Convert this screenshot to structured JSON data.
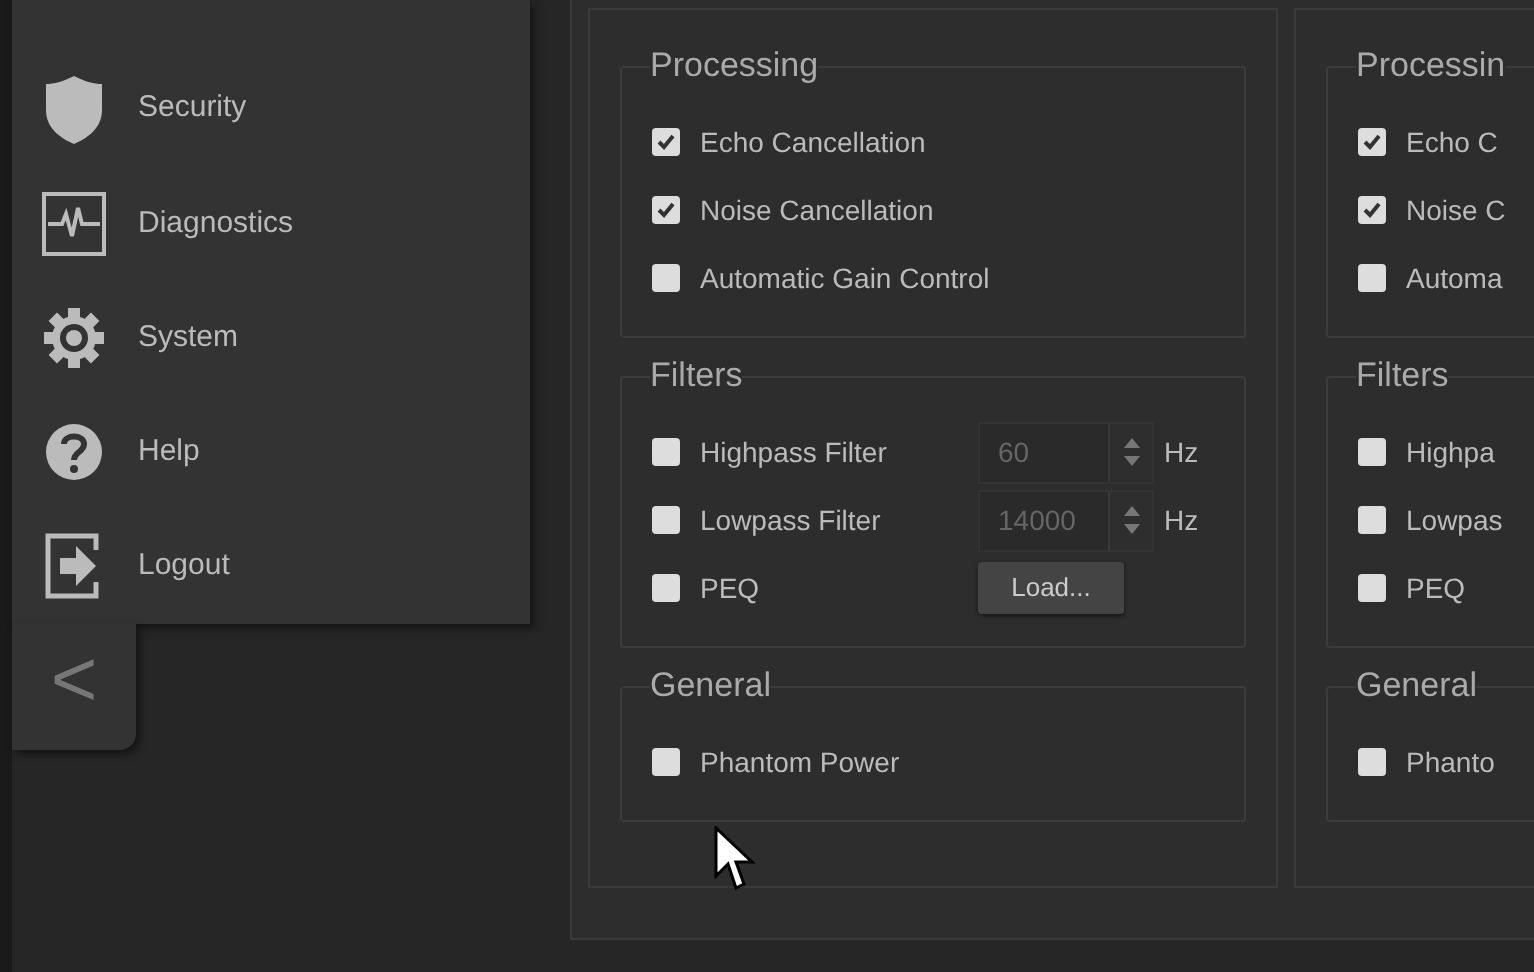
{
  "sidebar": {
    "items": [
      {
        "label": "Security"
      },
      {
        "label": "Diagnostics"
      },
      {
        "label": "System"
      },
      {
        "label": "Help"
      },
      {
        "label": "Logout"
      }
    ],
    "collapse_button": "<"
  },
  "channels": [
    {
      "sections": [
        {
          "title": "Processing",
          "rows": [
            {
              "kind": "checkbox",
              "label": "Echo Cancellation",
              "checked": true
            },
            {
              "kind": "checkbox",
              "label": "Noise Cancellation",
              "checked": true
            },
            {
              "kind": "checkbox",
              "label": "Automatic Gain Control",
              "checked": false
            }
          ]
        },
        {
          "title": "Filters",
          "rows": [
            {
              "kind": "number",
              "label": "Highpass Filter",
              "checked": false,
              "value": "60",
              "unit": "Hz"
            },
            {
              "kind": "number",
              "label": "Lowpass Filter",
              "checked": false,
              "value": "14000",
              "unit": "Hz"
            },
            {
              "kind": "button",
              "label": "PEQ",
              "checked": false,
              "button": "Load..."
            }
          ]
        },
        {
          "title": "General",
          "rows": [
            {
              "kind": "checkbox",
              "label": "Phantom Power",
              "checked": false
            }
          ]
        }
      ]
    },
    {
      "sections": [
        {
          "title": "Processin",
          "rows": [
            {
              "kind": "checkbox",
              "label": "Echo C",
              "checked": true
            },
            {
              "kind": "checkbox",
              "label": "Noise C",
              "checked": true
            },
            {
              "kind": "checkbox",
              "label": "Automa",
              "checked": false
            }
          ]
        },
        {
          "title": "Filters",
          "rows": [
            {
              "kind": "checkbox",
              "label": "Highpa",
              "checked": false
            },
            {
              "kind": "checkbox",
              "label": "Lowpas",
              "checked": false
            },
            {
              "kind": "checkbox",
              "label": "PEQ",
              "checked": false
            }
          ]
        },
        {
          "title": "General",
          "rows": [
            {
              "kind": "checkbox",
              "label": "Phanto",
              "checked": false
            }
          ]
        }
      ]
    }
  ]
}
